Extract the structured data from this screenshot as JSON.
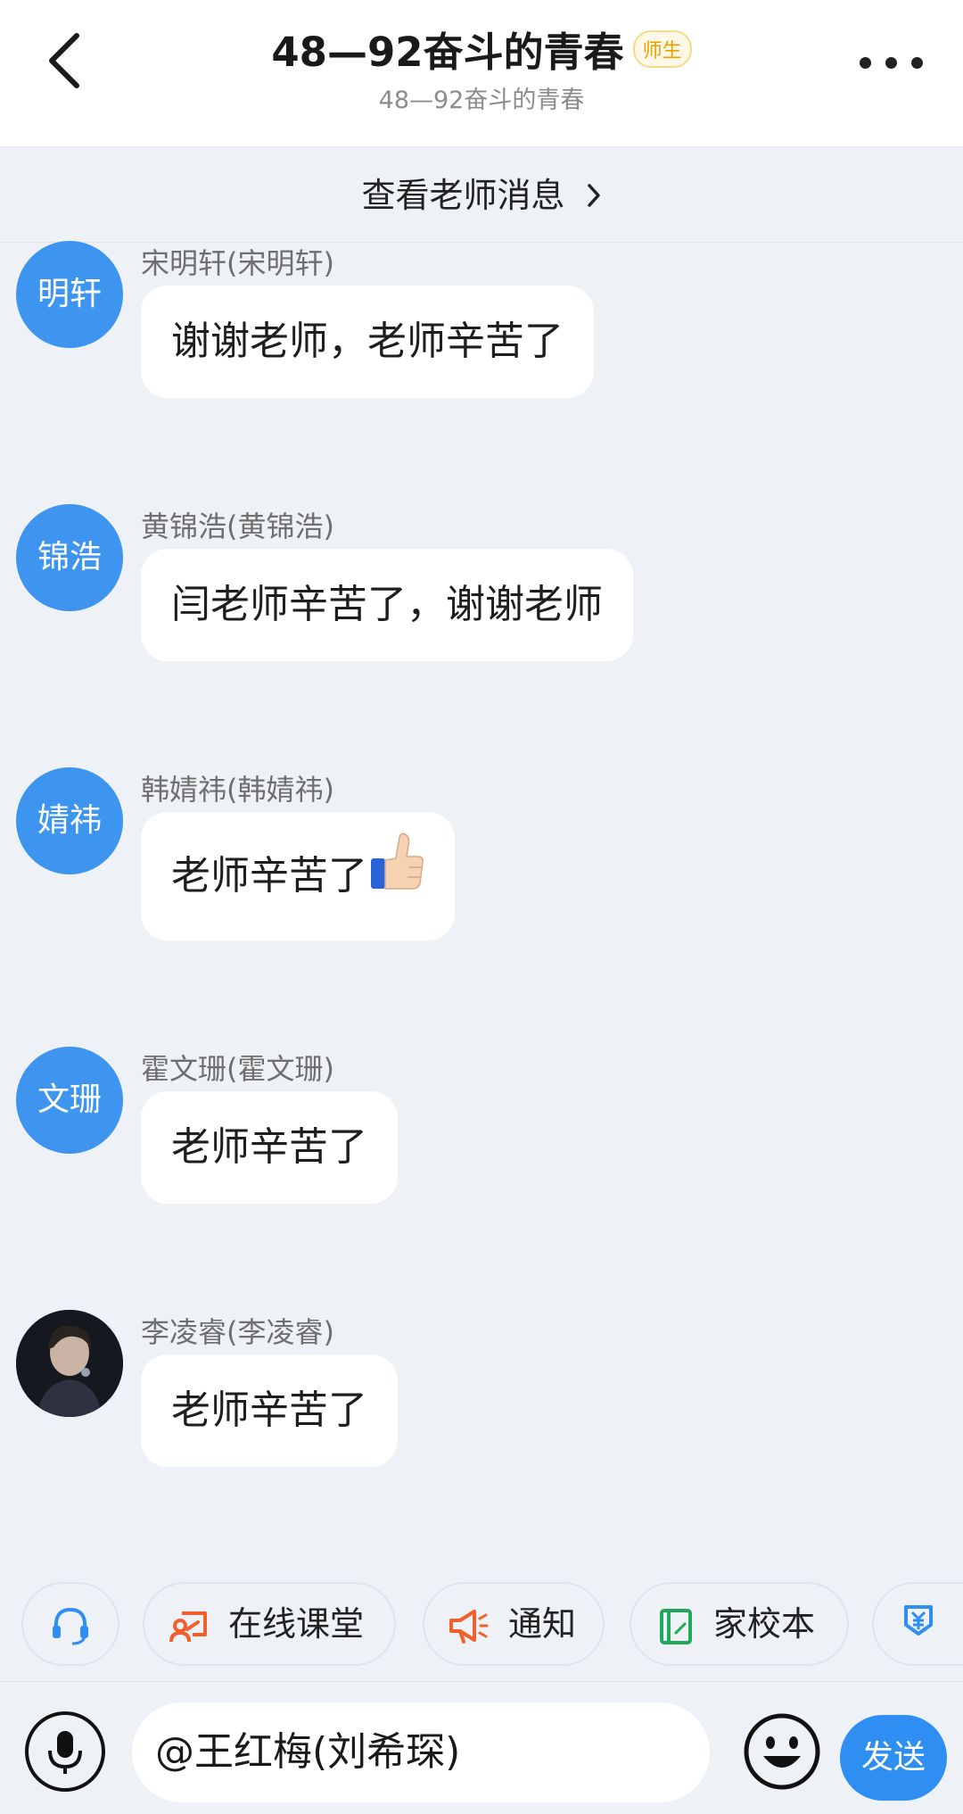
{
  "header": {
    "title": "48—92奋斗的青春",
    "badge": "师生",
    "subtitle": "48—92奋斗的青春"
  },
  "teacher_bar": {
    "label": "查看老师消息"
  },
  "messages": [
    {
      "avatar_text": "明轩",
      "sender": "宋明轩(宋明轩)",
      "text": "谢谢老师，老师辛苦了"
    },
    {
      "avatar_text": "锦浩",
      "sender": "黄锦浩(黄锦浩)",
      "text": "闫老师辛苦了，谢谢老师"
    },
    {
      "avatar_text": "婧祎",
      "sender": "韩婧祎(韩婧祎)",
      "text": "老师辛苦了",
      "emoji": "thumbs-up-icon"
    },
    {
      "avatar_text": "文珊",
      "sender": "霍文珊(霍文珊)",
      "text": "老师辛苦了"
    },
    {
      "avatar_image": "profile-photo",
      "sender": "李凌睿(李凌睿)",
      "text": "老师辛苦了"
    }
  ],
  "quick_actions": [
    {
      "label": "",
      "icon": "headset-icon"
    },
    {
      "label": "在线课堂",
      "icon": "online-classroom-icon"
    },
    {
      "label": "通知",
      "icon": "megaphone-icon"
    },
    {
      "label": "家校本",
      "icon": "notebook-icon"
    },
    {
      "label": "",
      "icon": "payment-icon"
    }
  ],
  "input": {
    "value": "@王红梅(刘希琛)",
    "send_label": "发送"
  },
  "colors": {
    "accent": "#2e8ef2",
    "avatar_bg": "#3d95ef",
    "badge": "#e8a100",
    "background": "#eef1f5"
  }
}
